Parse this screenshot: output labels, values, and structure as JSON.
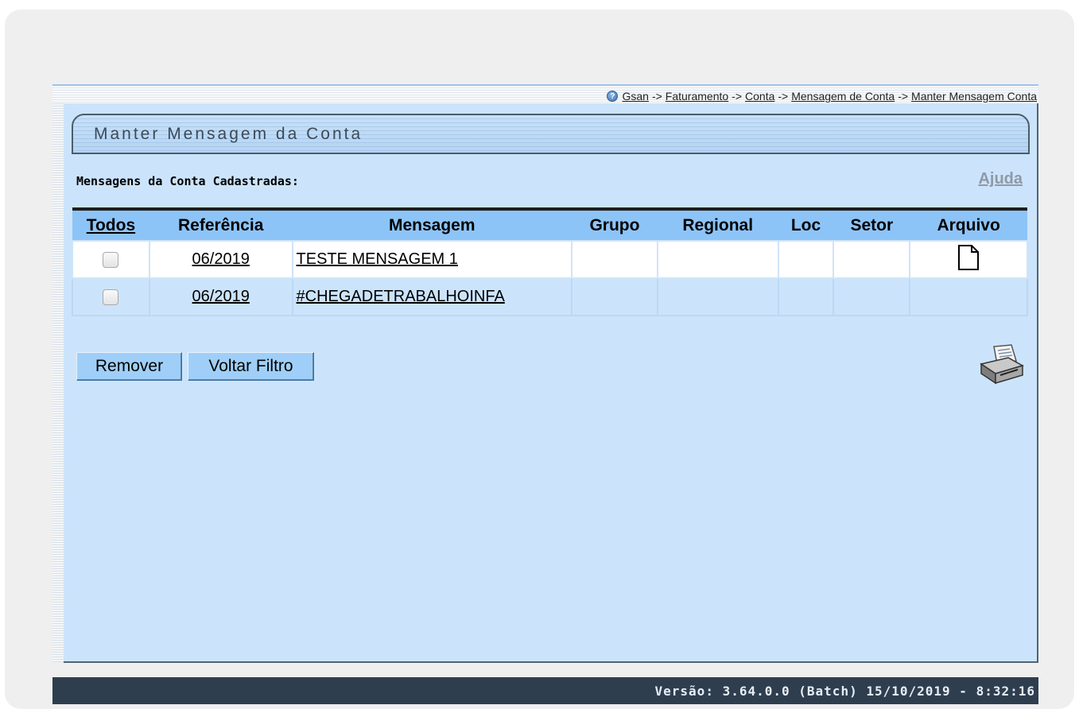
{
  "breadcrumb": {
    "items": [
      "Gsan",
      "Faturamento",
      "Conta",
      "Mensagem de Conta",
      "Manter Mensagem Conta"
    ],
    "separator": "->"
  },
  "page": {
    "title": "Manter Mensagem da Conta",
    "section_label": "Mensagens da Conta Cadastradas:",
    "help_link": "Ajuda"
  },
  "table": {
    "headers": {
      "todos": "Todos",
      "referencia": "Referência",
      "mensagem": "Mensagem",
      "grupo": "Grupo",
      "regional": "Regional",
      "loc": "Loc",
      "setor": "Setor",
      "arquivo": "Arquivo"
    },
    "rows": [
      {
        "referencia": "06/2019",
        "mensagem": "TESTE MENSAGEM 1",
        "grupo": "",
        "regional": "",
        "loc": "",
        "setor": "",
        "arquivo_icon": "document-icon",
        "checked": false
      },
      {
        "referencia": "06/2019",
        "mensagem": "#CHEGADETRABALHOINFA",
        "grupo": "",
        "regional": "",
        "loc": "",
        "setor": "",
        "arquivo_icon": "",
        "checked": false
      }
    ]
  },
  "buttons": {
    "remove": "Remover",
    "back_filter": "Voltar Filtro"
  },
  "icons": {
    "help": "help-circle-icon",
    "print": "printer-icon"
  },
  "footer": {
    "version_text": "Versão: 3.64.0.0 (Batch) 15/10/2019 - 8:32:16"
  },
  "colors": {
    "panel_bg": "#cce4fb",
    "header_bg": "#8dc4f7",
    "footer_bg": "#2f3e4f"
  }
}
